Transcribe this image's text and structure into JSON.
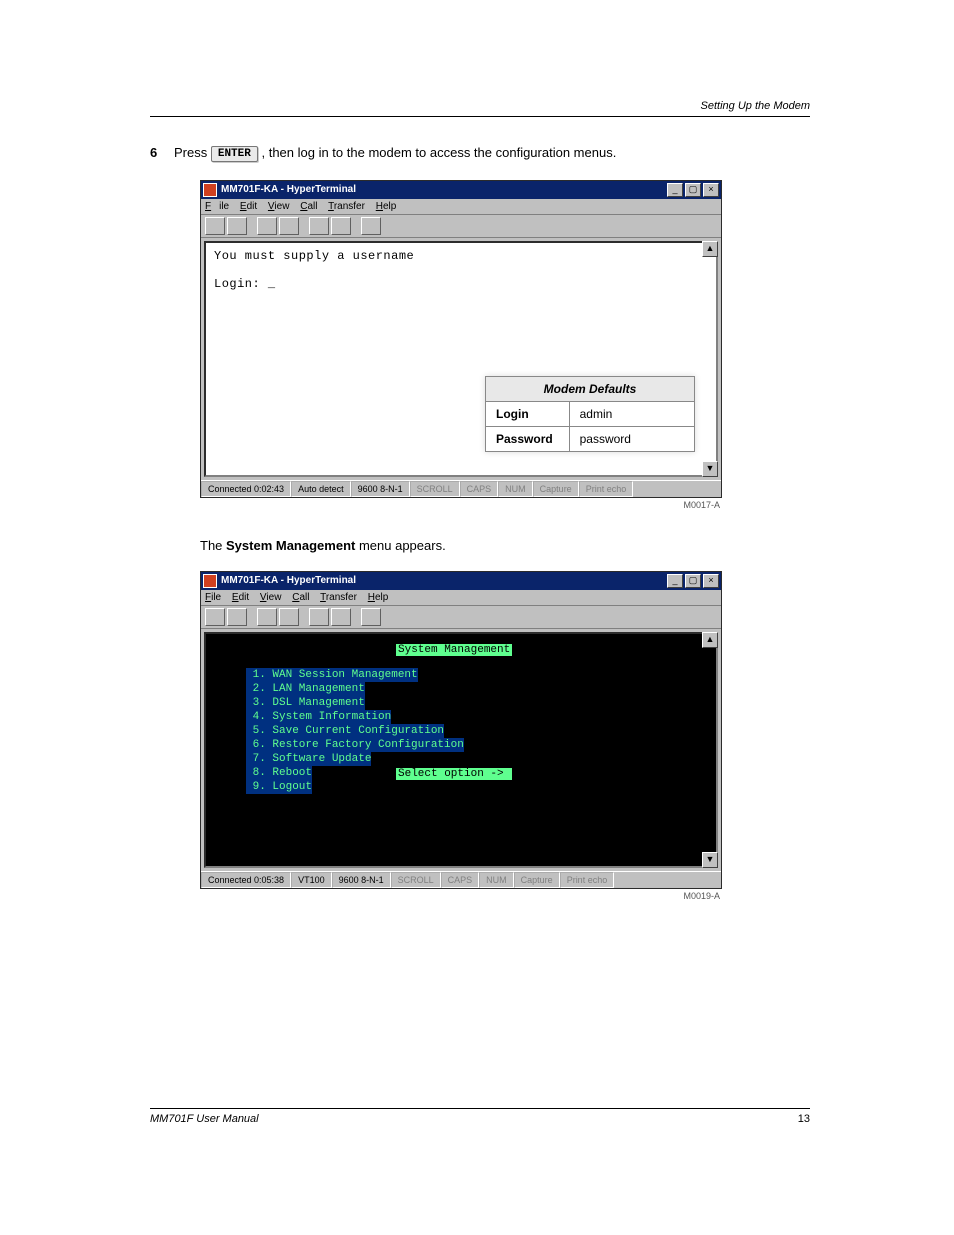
{
  "header_right": "Setting Up the Modem",
  "step6": {
    "num": "6",
    "pre_text": "Press ",
    "key": "ENTER",
    "post_text": ", then log in to the modem to access the configuration menus."
  },
  "ht1": {
    "title": "MM701F-KA - HyperTerminal",
    "menus": [
      "File",
      "Edit",
      "View",
      "Call",
      "Transfer",
      "Help"
    ],
    "console_line1": "You must supply a username",
    "console_line2": "Login: _",
    "status": {
      "conn": "Connected 0:02:43",
      "mode": "Auto detect",
      "baud": "9600 8-N-1",
      "scroll": "SCROLL",
      "caps": "CAPS",
      "num": "NUM",
      "capture": "Capture",
      "print": "Print echo"
    },
    "img_label": "M0017-A"
  },
  "defaults": {
    "header": "Modem Defaults",
    "login_lbl": "Login",
    "login_val": "admin",
    "pass_lbl": "Password",
    "pass_val": "password"
  },
  "sys_mgmt_line": {
    "pre": "The ",
    "bold": "System Management",
    "post": " menu appears."
  },
  "ht2": {
    "title": "MM701F-KA - HyperTerminal",
    "menus": [
      "File",
      "Edit",
      "View",
      "Call",
      "Transfer",
      "Help"
    ],
    "sys_title": "System Management",
    "menu_items": [
      " 1. WAN Session Management",
      " 2. LAN Management",
      " 3. DSL Management",
      " 4. System Information",
      " 5. Save Current Configuration",
      " 6. Restore Factory Configuration",
      " 7. Software Update",
      " 8. Reboot",
      " 9. Logout"
    ],
    "select_opt": "Select option -> ",
    "status": {
      "conn": "Connected 0:05:38",
      "mode": "VT100",
      "baud": "9600 8-N-1",
      "scroll": "SCROLL",
      "caps": "CAPS",
      "num": "NUM",
      "capture": "Capture",
      "print": "Print echo"
    },
    "img_label": "M0019-A"
  },
  "footer": {
    "left": "MM701F User Manual",
    "right": "13"
  }
}
